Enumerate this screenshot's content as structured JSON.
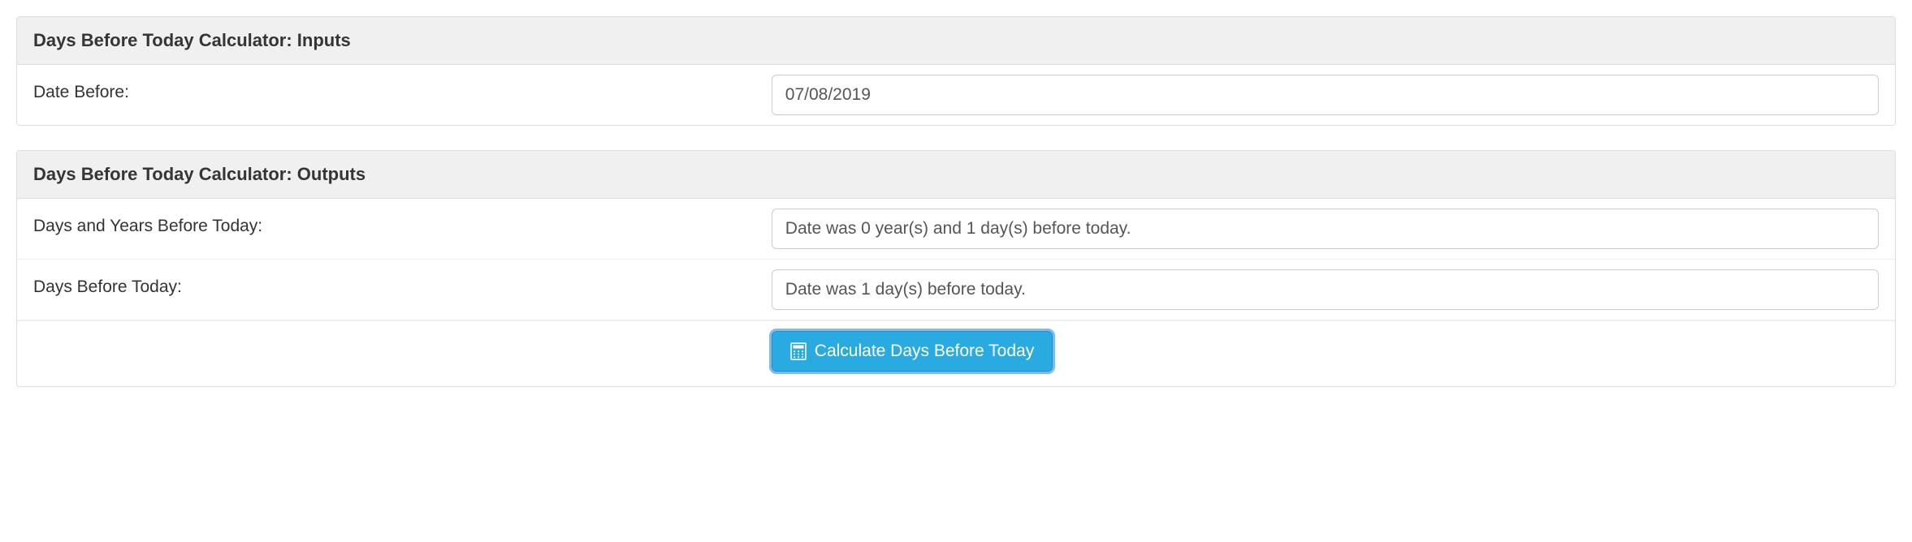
{
  "inputs": {
    "header": "Days Before Today Calculator: Inputs",
    "date_before_label": "Date Before:",
    "date_before_value": "07/08/2019"
  },
  "outputs": {
    "header": "Days Before Today Calculator: Outputs",
    "days_years_label": "Days and Years Before Today:",
    "days_years_value": "Date was 0 year(s) and 1 day(s) before today.",
    "days_label": "Days Before Today:",
    "days_value": "Date was 1 day(s) before today.",
    "button_label": "Calculate Days Before Today"
  }
}
